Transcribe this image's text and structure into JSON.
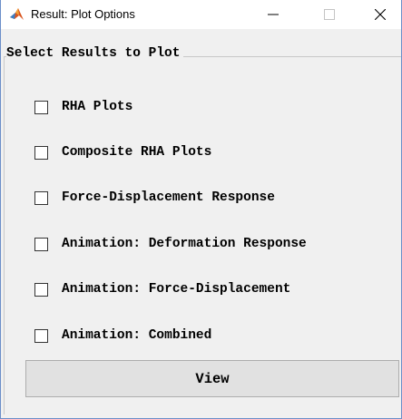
{
  "window": {
    "title": "Result: Plot Options",
    "icon": "matlab-icon",
    "controls": [
      "minimize-icon",
      "maximize-icon",
      "close-icon"
    ]
  },
  "group": {
    "title": "Select Results to Plot",
    "options": [
      {
        "label": "RHA Plots",
        "checked": false
      },
      {
        "label": "Composite RHA Plots",
        "checked": false
      },
      {
        "label": "Force-Displacement Response",
        "checked": false
      },
      {
        "label": "Animation: Deformation Response",
        "checked": false
      },
      {
        "label": "Animation: Force-Displacement",
        "checked": false
      },
      {
        "label": "Animation: Combined",
        "checked": false
      }
    ]
  },
  "view_button": {
    "label": "View"
  },
  "colors": {
    "window_border": "#6b8fc9",
    "background": "#f0f0f0",
    "button": "#e1e1e1"
  }
}
